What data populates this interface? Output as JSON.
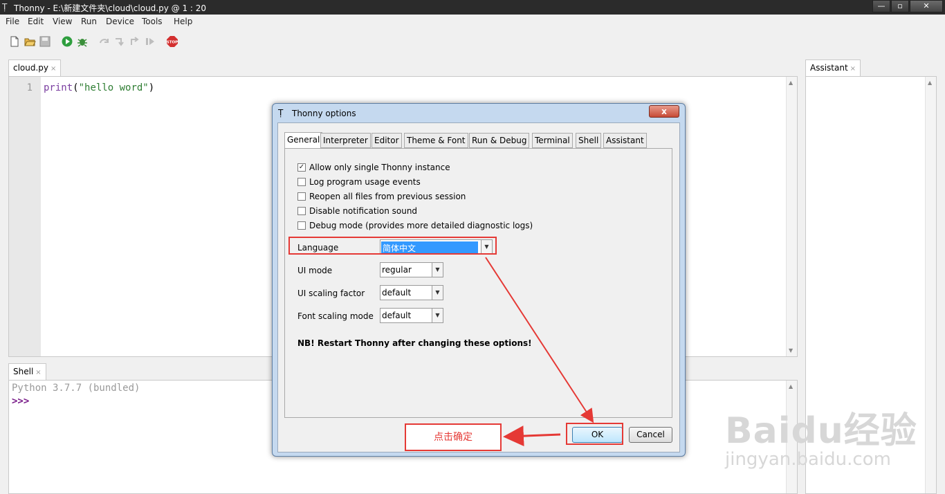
{
  "window": {
    "title": "Thonny  -  E:\\新建文件夹\\cloud\\cloud.py  @  1 : 20",
    "controls": {
      "minimize": "—",
      "maximize": "▫",
      "close": "✕"
    }
  },
  "menu": [
    "File",
    "Edit",
    "View",
    "Run",
    "Device",
    "Tools",
    "Help"
  ],
  "toolbar": {
    "icons": [
      "new-file-icon",
      "open-folder-icon",
      "save-icon",
      "run-icon",
      "debug-icon",
      "step-over-icon",
      "step-into-icon",
      "step-out-icon",
      "resume-icon",
      "stop-icon"
    ],
    "stop_label": "STOP"
  },
  "editor": {
    "tab_label": "cloud.py",
    "tab_close": "×",
    "line_number": "1",
    "code_keyword": "print",
    "code_open": "(",
    "code_string": "\"hello word\"",
    "code_close": ")"
  },
  "shell": {
    "tab_label": "Shell",
    "tab_close": "×",
    "version_line": "Python 3.7.7 (bundled)",
    "prompt": ">>>"
  },
  "assistant": {
    "tab_label": "Assistant",
    "tab_close": "×"
  },
  "dialog": {
    "title": "Thonny options",
    "close_symbol": "x",
    "tabs": [
      "General",
      "Interpreter",
      "Editor",
      "Theme & Font",
      "Run & Debug",
      "Terminal",
      "Shell",
      "Assistant"
    ],
    "active_tab": "General",
    "checkboxes": [
      {
        "label": "Allow only single Thonny instance",
        "checked": true
      },
      {
        "label": "Log program usage events",
        "checked": false
      },
      {
        "label": "Reopen all files from previous session",
        "checked": false
      },
      {
        "label": "Disable notification sound",
        "checked": false
      },
      {
        "label": "Debug mode (provides more detailed diagnostic logs)",
        "checked": false
      }
    ],
    "fields": [
      {
        "label": "Language",
        "value": "简体中文"
      },
      {
        "label": "UI mode",
        "value": "regular"
      },
      {
        "label": "UI scaling factor",
        "value": "default"
      },
      {
        "label": "Font scaling mode",
        "value": "default"
      }
    ],
    "note": "NB! Restart Thonny after changing these options!",
    "ok_label": "OK",
    "cancel_label": "Cancel"
  },
  "annotation": {
    "callout_text": "点击确定",
    "color": "#e53935"
  },
  "watermark": {
    "brand": "Baidu经验",
    "url": "jingyan.baidu.com"
  },
  "colors": {
    "titlebar": "#2b2b2b",
    "selection": "#3399ff",
    "keyword": "#7a3ea0",
    "string": "#2e7d32"
  }
}
